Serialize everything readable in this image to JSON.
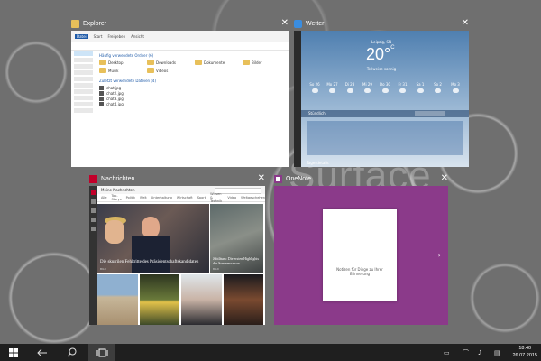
{
  "desktop": {
    "watermark": "Surface"
  },
  "windows": {
    "explorer": {
      "title": "Explorer",
      "tabs": [
        "Datei",
        "Start",
        "Freigeben",
        "Ansicht"
      ],
      "section_frequent": "Häufig verwendete Ordner (6)",
      "folders": [
        "Desktop",
        "Downloads",
        "Dokumente",
        "Bilder",
        "Musik",
        "Videos"
      ],
      "section_recent": "Zuletzt verwendete Dateien (4)",
      "files": [
        "chat.jpg",
        "chat2.jpg",
        "chat3.jpg",
        "chat4.jpg"
      ]
    },
    "weather": {
      "title": "Wetter",
      "location": "Leipzig, SN",
      "temperature": "20°",
      "unit": "C",
      "condition": "Teilweise sonnig",
      "days": [
        "So 26",
        "Mo 27",
        "Di 28",
        "Mi 29",
        "Do 30",
        "Fr 31",
        "Sa 1",
        "So 2",
        "Mo 3"
      ],
      "hourly_label": "Stündlich",
      "footer": "Tagesdetails"
    },
    "news": {
      "title": "Nachrichten",
      "header": "Meine Nachrichten",
      "nav": [
        "Alle",
        "Top-Storys",
        "Politik",
        "Welt",
        "Unterhaltung",
        "Wirtschaft",
        "Sport",
        "Wissen & Technik",
        "Video",
        "Weltgeschehen"
      ],
      "main_headline": "Die skurrilen Fehltritte des Präsidentschaftskandidaten",
      "main_source": "BILD",
      "side_headline": "Jubiläum: Die ersten Highlights der Sommersaison",
      "side_source": "BILD"
    },
    "onenote": {
      "title": "OneNote",
      "page_text": "Notizen für Dinge zu Ihrer Erinnerung"
    }
  },
  "taskbar": {
    "time": "18:40",
    "date": "26.07.2015"
  }
}
